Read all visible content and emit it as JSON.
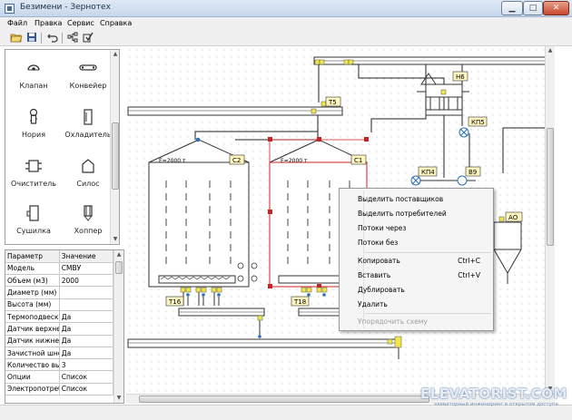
{
  "window": {
    "title": "Безимени - Зернотех"
  },
  "menu": [
    "Файл",
    "Правка",
    "Сервис",
    "Справка"
  ],
  "toolbar": [
    {
      "icon": "open-folder-icon"
    },
    {
      "icon": "save-icon"
    },
    {
      "icon": "undo-icon"
    },
    {
      "icon": "tree-icon"
    },
    {
      "icon": "check-icon"
    }
  ],
  "palette": [
    {
      "label": "Клапан",
      "icon": "valve-icon"
    },
    {
      "label": "Конвейер",
      "icon": "conveyor-icon"
    },
    {
      "label": "Нория",
      "icon": "elevator-icon"
    },
    {
      "label": "Охладитель",
      "icon": "cooler-icon"
    },
    {
      "label": "Очиститель",
      "icon": "cleaner-icon"
    },
    {
      "label": "Силос",
      "icon": "silo-icon"
    },
    {
      "label": "Сушилка",
      "icon": "dryer-icon"
    },
    {
      "label": "Хоппер",
      "icon": "hopper-icon"
    }
  ],
  "properties": {
    "header": [
      "Параметр",
      "Значение"
    ],
    "rows": [
      [
        "Модель",
        "СМВУ"
      ],
      [
        "Объем (м3)",
        "2000"
      ],
      [
        "Диаметр (мм)",
        ""
      ],
      [
        "Высота (мм)",
        ""
      ],
      [
        "Термоподвески",
        "Да"
      ],
      [
        "Датчик верхнег",
        "Да"
      ],
      [
        "Датчик нижнего",
        "Да"
      ],
      [
        "Зачистной шнек",
        "Да"
      ],
      [
        "Количество выхо",
        "3"
      ],
      [
        "Опции",
        "Список"
      ],
      [
        "Электропотребит",
        "Список"
      ]
    ]
  },
  "diagram": {
    "labels": {
      "t5": "Т5",
      "t16": "Т16",
      "t18": "Т18",
      "c1": "С1",
      "c2": "С2",
      "h6": "Н6",
      "kp5": "КП5",
      "kp4": "КП4",
      "b9": "В9",
      "ao": "АО",
      "silo_capacity": "Е=2000 т"
    }
  },
  "context_menu": {
    "items": [
      {
        "label": "Выделить поставщиков",
        "shortcut": "",
        "enabled": true
      },
      {
        "label": "Выделить потребителей",
        "shortcut": "",
        "enabled": true
      },
      {
        "label": "Потоки через",
        "shortcut": "",
        "enabled": true
      },
      {
        "label": "Потоки без",
        "shortcut": "",
        "enabled": true
      },
      {
        "label": "Копировать",
        "shortcut": "Ctrl+C",
        "enabled": true
      },
      {
        "label": "Вставить",
        "shortcut": "Ctrl+V",
        "enabled": true
      },
      {
        "label": "Дублировать",
        "shortcut": "",
        "enabled": true
      },
      {
        "label": "Удалить",
        "shortcut": "",
        "enabled": true
      },
      {
        "label": "Упорядочить схему",
        "shortcut": "",
        "enabled": false
      }
    ]
  },
  "watermark": {
    "text": "ELEVATORIST.COM",
    "sub": "элеваторный инжиниринг в открытом доступе"
  },
  "colors": {
    "selection": "#cc2222",
    "connector": "#2b6fb3",
    "port": "#f2e64a",
    "tag_bg": "#fff6c0"
  }
}
